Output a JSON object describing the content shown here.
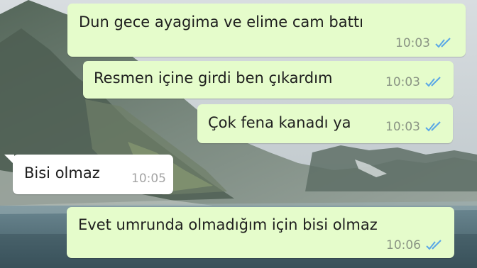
{
  "chat": {
    "messages": [
      {
        "direction": "out",
        "text": "Dun gece ayagima ve elime cam battı",
        "time": "10:03",
        "status_icon": "double-check-read-icon"
      },
      {
        "direction": "out",
        "text": "Resmen içine girdi ben çıkardım",
        "time": "10:03",
        "status_icon": "double-check-read-icon"
      },
      {
        "direction": "out",
        "text": "Çok fena kanadı ya",
        "time": "10:03",
        "status_icon": "double-check-read-icon"
      },
      {
        "direction": "in",
        "text": "Bisi olmaz",
        "time": "10:05"
      },
      {
        "direction": "out",
        "text": "Evet umrunda olmadığım için bisi olmaz",
        "time": "10:06",
        "status_icon": "double-check-read-icon"
      }
    ]
  },
  "colors": {
    "outgoing_bubble": "#e5fccb",
    "incoming_bubble": "#ffffff",
    "read_ticks": "#5aa7e6"
  },
  "wallpaper": "mountain-lake-landscape"
}
